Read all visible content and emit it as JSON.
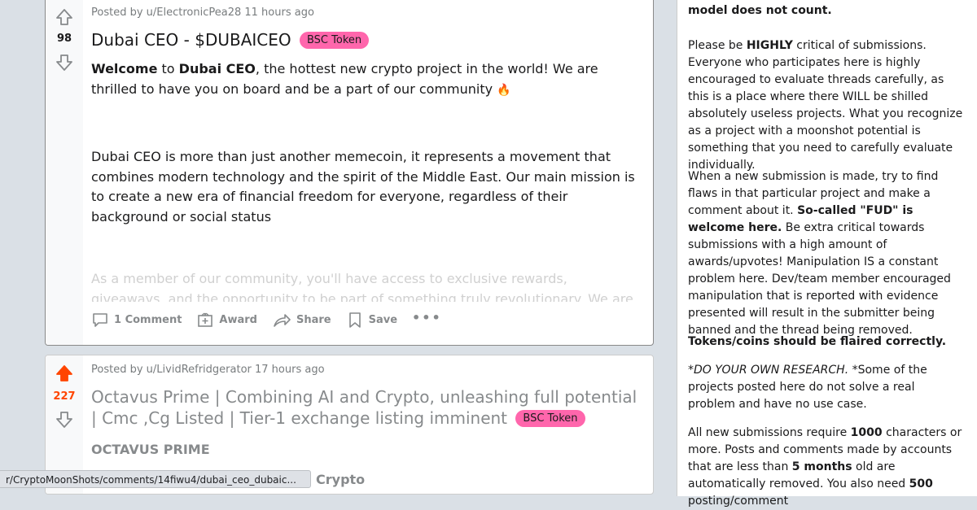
{
  "posts": [
    {
      "votes": "98",
      "meta": "Posted by u/ElectronicPea28 11 hours ago",
      "title": "Dubai CEO - $DUBAICEO",
      "flair": "BSC Token",
      "p1_welcome": "Welcome",
      "p1_to": " to ",
      "p1_brand": "Dubai CEO",
      "p1_rest": ", the hottest new crypto project in the world! We are thrilled to have you on board and be a part of our community ",
      "p1_emoji": "🔥",
      "p2": "Dubai CEO is more than just another memecoin, it represents a movement that combines modern technology and the spirit of the Middle East. Our main mission is to create a new era of financial freedom for everyone, regardless of their background or social status",
      "faded": "As a member of our community, you'll have access to exclusive rewards, giveaways, and the opportunity to be part of something truly revolutionary. We are dedicated to",
      "actions": {
        "comments": "1 Comment",
        "award": "Award",
        "share": "Share",
        "save": "Save",
        "more": "•••"
      }
    },
    {
      "votes": "227",
      "meta": "Posted by u/LividRefridgerator 17 hours ago",
      "title": "Octavus Prime | Combining AI and Crypto, unleashing full potential | Cmc ,Cg Listed | Tier-1 exchange listing imminent",
      "flair": "BSC Token",
      "subhead": "OCTAVUS PRIME"
    }
  ],
  "sidebar": {
    "top_bold": "utility. No, simply using a deflationary model does not count.",
    "para1_a": "Please be ",
    "para1_b": "HIGHLY",
    "para1_c": " critical of submissions. Everyone who participates here is highly encouraged to evaluate threads carefully, as this is a place where there WILL be shilled absolutely useless projects. What you recognize as a project with a moonshot potential is something that you need to carefully evaluate individually.",
    "para2_a": "When a new submission is made, try to find flaws in that particular project and make a comment about it. ",
    "para2_b": "So-called \"FUD\" is welcome here.",
    "para2_c": " Be extra critical towards submissions with a high amount of awards/upvotes! Manipulation IS a constant problem here. Dev/team member encouraged manipulation that is reported with evidence presented will result in the submitter being banned and the thread being removed.",
    "para3": "Tokens/coins should be flaired correctly.",
    "para4_a": "*DO YOUR OWN RESEARCH.",
    "para4_b": " *Some of the projects posted here do not solve a real problem and have no use case.",
    "para5_a": "All new submissions require ",
    "para5_b": "1000",
    "para5_c": " characters or more. Posts and comments made by accounts that are less than ",
    "para5_d": "5 months",
    "para5_e": " old are automatically removed. You also need ",
    "para5_f": "500",
    "para5_g": " posting/comment"
  },
  "status_url": "r/CryptoMoonShots/comments/14fiwu4/dubai_ceo_dubaic...",
  "bottom_peek": "Crypto",
  "colors": {
    "upvote_active": "#ff4500",
    "upvote_count_active": "#ff4500",
    "flair_bg": "#ff66ac",
    "background": "#dae0e6"
  }
}
